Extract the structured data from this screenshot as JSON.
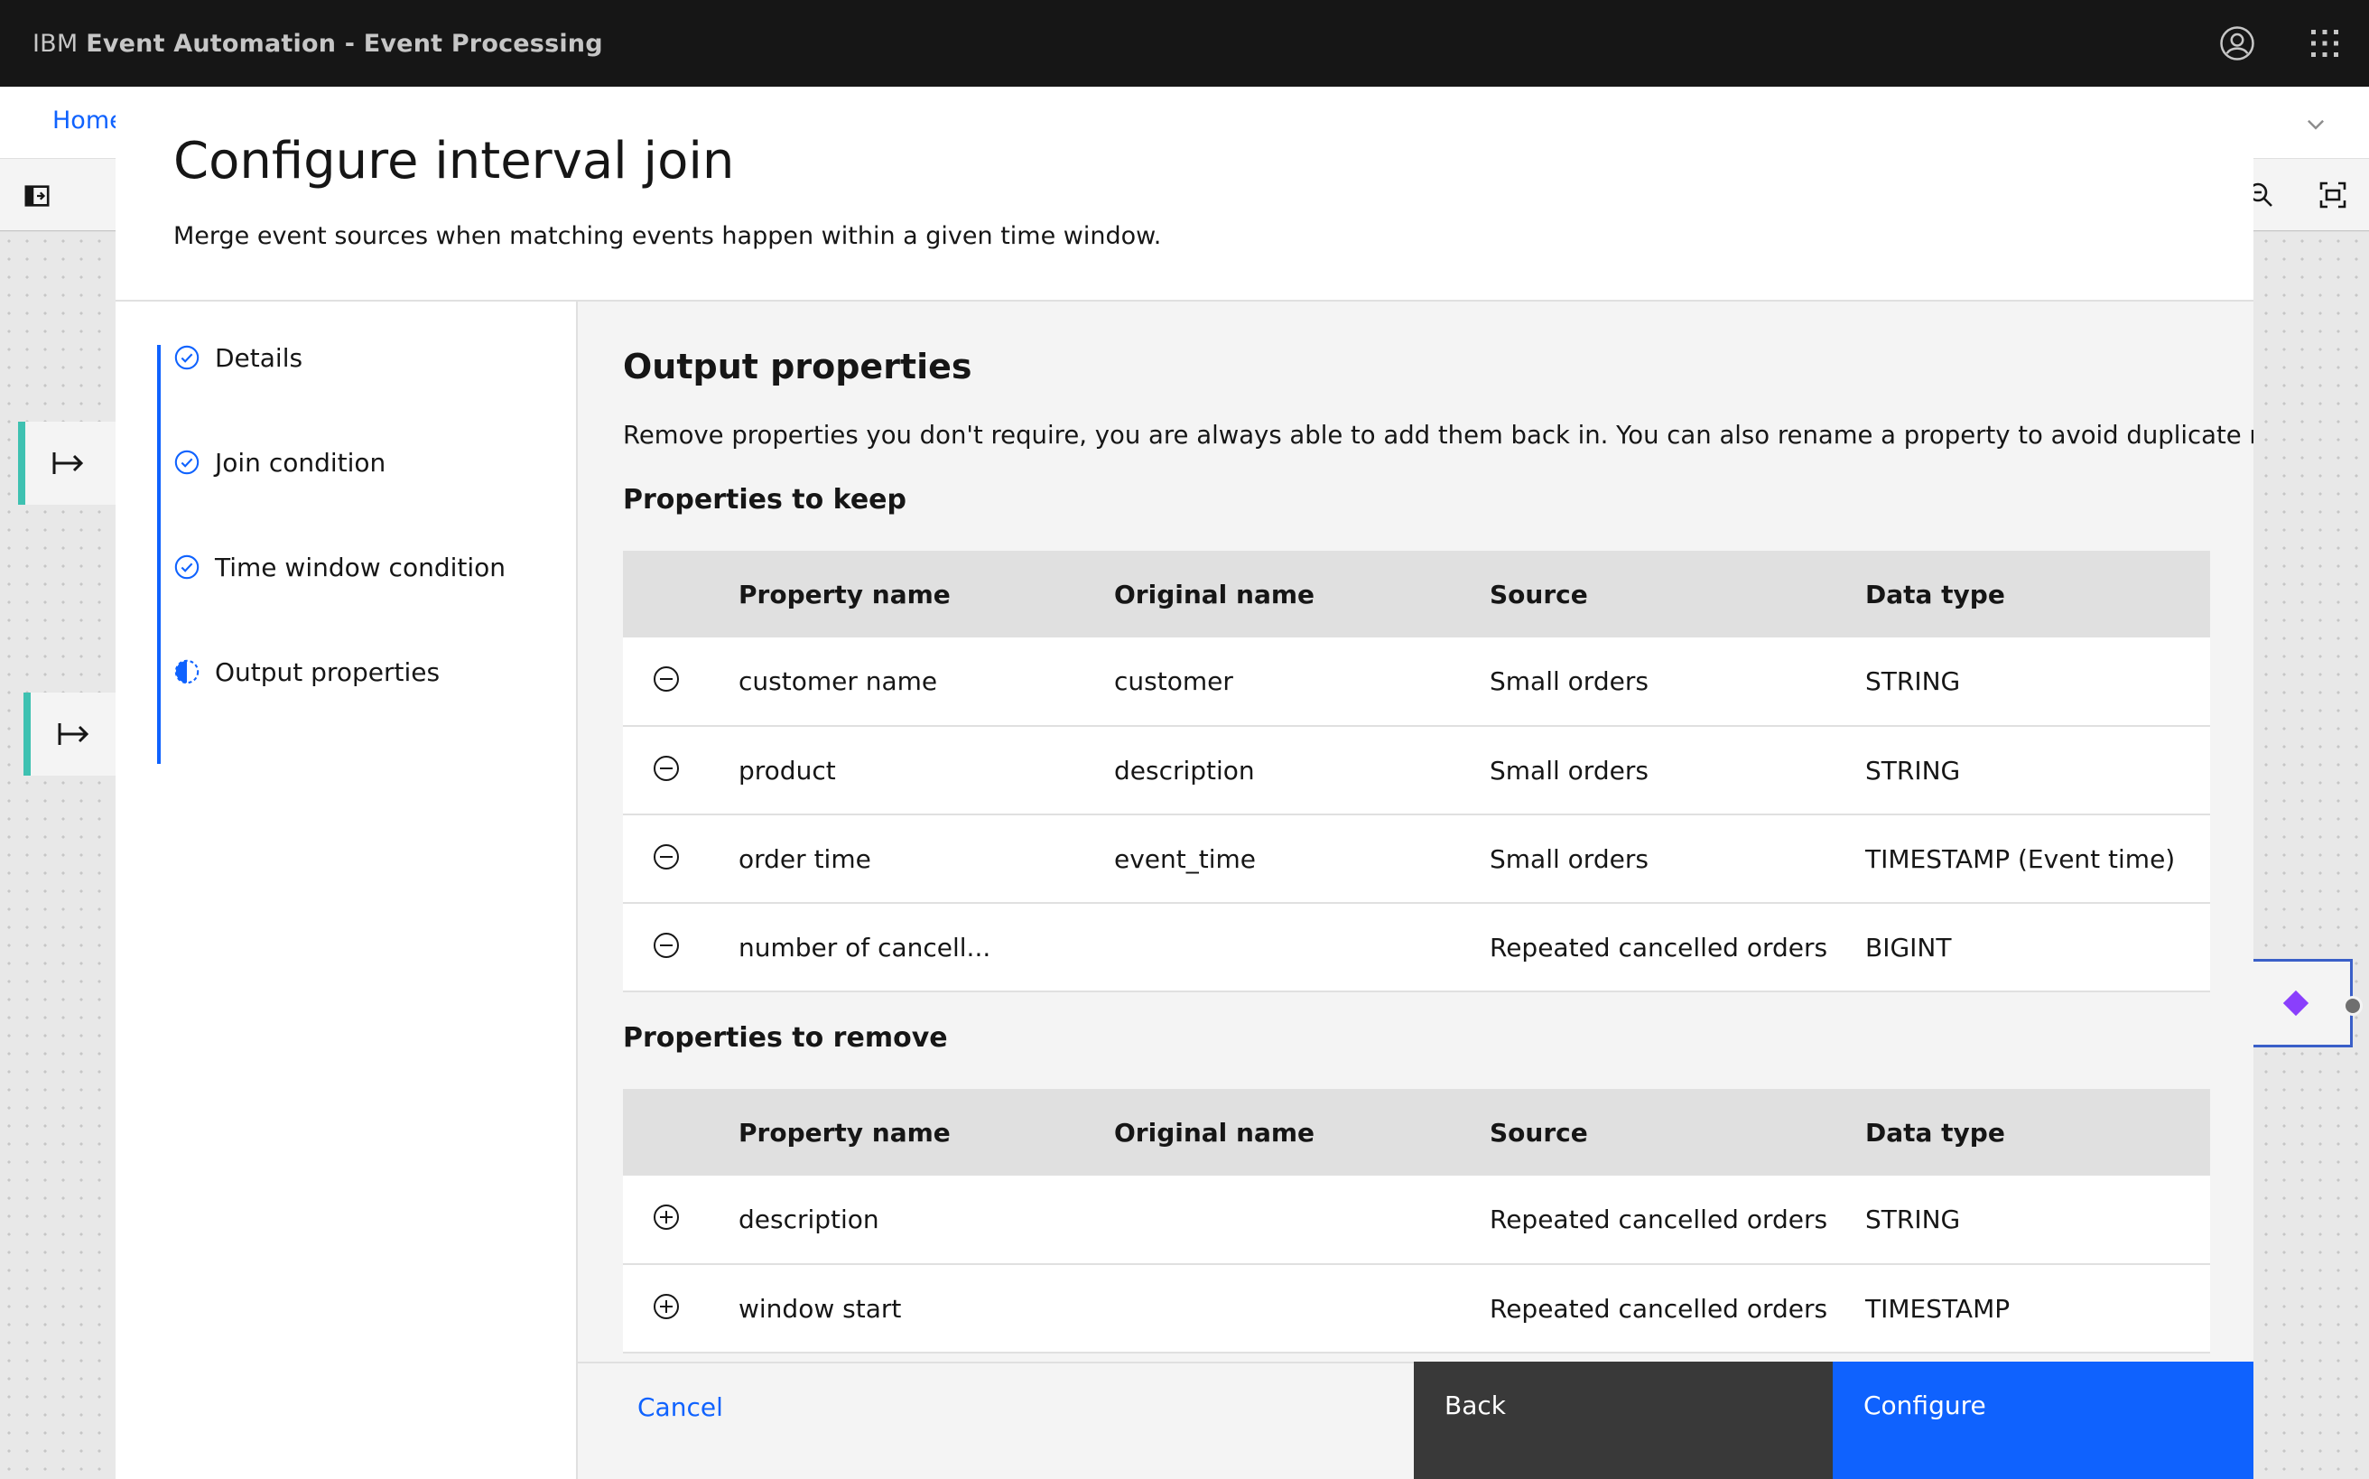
{
  "shell": {
    "brand_prefix": "IBM",
    "brand_name": "Event Automation - Event Processing"
  },
  "background": {
    "home_link": "Home"
  },
  "modal": {
    "title": "Configure interval join",
    "subtitle": "Merge event sources when matching events happen within a given time window."
  },
  "steps": [
    {
      "label": "Details",
      "state": "complete"
    },
    {
      "label": "Join condition",
      "state": "complete"
    },
    {
      "label": "Time window condition",
      "state": "complete"
    },
    {
      "label": "Output properties",
      "state": "current"
    }
  ],
  "content": {
    "title": "Output properties",
    "description": "Remove properties you don't require, you are always able to add them back in. You can also rename a property to avoid duplicate names.",
    "keep_heading": "Properties to keep",
    "remove_heading": "Properties to remove",
    "columns": [
      "Property name",
      "Original name",
      "Source",
      "Data type"
    ],
    "keep_rows": [
      {
        "property": "customer name",
        "original": "customer",
        "source": "Small orders",
        "type": "STRING"
      },
      {
        "property": "product",
        "original": "description",
        "source": "Small orders",
        "type": "STRING"
      },
      {
        "property": "order time",
        "original": "event_time",
        "source": "Small orders",
        "type": "TIMESTAMP (Event time)"
      },
      {
        "property": "number of cancell...",
        "original": "",
        "source": "Repeated cancelled orders",
        "type": "BIGINT"
      }
    ],
    "remove_rows": [
      {
        "property": "description",
        "original": "",
        "source": "Repeated cancelled orders",
        "type": "STRING"
      },
      {
        "property": "window start",
        "original": "",
        "source": "Repeated cancelled orders",
        "type": "TIMESTAMP"
      }
    ]
  },
  "footer": {
    "cancel": "Cancel",
    "back": "Back",
    "configure": "Configure"
  },
  "colors": {
    "primary": "#0f62fe",
    "shell_bg": "#161616",
    "node_accent": "#3ec1b1"
  }
}
